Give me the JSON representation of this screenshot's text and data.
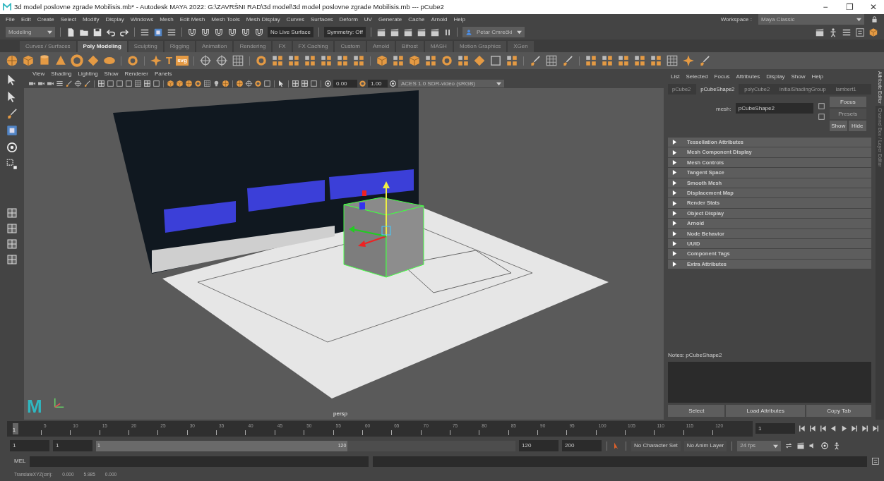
{
  "window": {
    "title": "3d model poslovne zgrade Mobilisis.mb* - Autodesk MAYA 2022: G:\\ZAVRŠNI RAD\\3d model\\3d model poslovne zgrade Mobilisis.mb  ---  pCube2",
    "controls": [
      "−",
      "❐",
      "✕"
    ]
  },
  "menu_bar": [
    "File",
    "Edit",
    "Create",
    "Select",
    "Modify",
    "Display",
    "Windows",
    "Mesh",
    "Edit Mesh",
    "Mesh Tools",
    "Mesh Display",
    "Curves",
    "Surfaces",
    "Deform",
    "UV",
    "Generate",
    "Cache",
    "Arnold",
    "Help"
  ],
  "workspace": {
    "label": "Workspace :",
    "value": "Maya Classic"
  },
  "status_line": {
    "mode": "Modeling",
    "live_surface": "No Live Surface",
    "symmetry": "Symmetry: Off",
    "user": "Petar Cmrečki"
  },
  "shelf": {
    "tabs": [
      {
        "label": "Curves / Surfaces",
        "selected": false
      },
      {
        "label": "Poly Modeling",
        "selected": true
      },
      {
        "label": "Sculpting",
        "selected": false
      },
      {
        "label": "Rigging",
        "selected": false
      },
      {
        "label": "Animation",
        "selected": false
      },
      {
        "label": "Rendering",
        "selected": false
      },
      {
        "label": "FX",
        "selected": false
      },
      {
        "label": "FX Caching",
        "selected": false
      },
      {
        "label": "Custom",
        "selected": false
      },
      {
        "label": "Arnold",
        "selected": false
      },
      {
        "label": "Bifrost",
        "selected": false
      },
      {
        "label": "MASH",
        "selected": false
      },
      {
        "label": "Motion Graphics",
        "selected": false
      },
      {
        "label": "XGen",
        "selected": false
      }
    ],
    "text_buttons": [
      "T",
      "svg"
    ]
  },
  "viewport": {
    "menus": [
      "View",
      "Shading",
      "Lighting",
      "Show",
      "Renderer",
      "Panels"
    ],
    "exposure": "0.00",
    "gamma": "1.00",
    "color_space": "ACES 1.0 SDR-video (sRGB)",
    "camera": "persp",
    "logo": "M"
  },
  "attribute_editor": {
    "menus": [
      "List",
      "Selected",
      "Focus",
      "Attributes",
      "Display",
      "Show",
      "Help"
    ],
    "tabs": [
      {
        "label": "pCube2",
        "selected": false
      },
      {
        "label": "pCubeShape2",
        "selected": true
      },
      {
        "label": "polyCube2",
        "selected": false
      },
      {
        "label": "initialShadingGroup",
        "selected": false
      },
      {
        "label": "lambert1",
        "selected": false
      }
    ],
    "node_label": "mesh:",
    "node_name": "pCubeShape2",
    "buttons": [
      {
        "label": "Focus",
        "disabled": false
      },
      {
        "label": "Presets",
        "disabled": true
      },
      {
        "label": "Show",
        "disabled": false
      },
      {
        "label": "Hide",
        "disabled": false
      }
    ],
    "sections": [
      {
        "label": "Tessellation Attributes",
        "expanded": false
      },
      {
        "label": "Mesh Component Display",
        "expanded": false
      },
      {
        "label": "Mesh Controls",
        "expanded": false
      },
      {
        "label": "Tangent Space",
        "expanded": false
      },
      {
        "label": "Smooth Mesh",
        "expanded": false
      },
      {
        "label": "Displacement Map",
        "expanded": false
      },
      {
        "label": "Render Stats",
        "expanded": false
      },
      {
        "label": "Object Display",
        "expanded": false
      },
      {
        "label": "Arnold",
        "expanded": false
      },
      {
        "label": "Node Behavior",
        "expanded": false
      },
      {
        "label": "UUID",
        "expanded": false
      },
      {
        "label": "Component Tags",
        "expanded": false
      },
      {
        "label": "Extra Attributes",
        "expanded": false
      }
    ],
    "notes_label": "Notes:  pCubeShape2",
    "bottom_buttons": [
      "Select",
      "Load Attributes",
      "Copy Tab"
    ]
  },
  "side_tabs": [
    {
      "label": "Attribute Editor",
      "selected": true
    },
    {
      "label": "Channel Box / Layer Editor",
      "selected": false
    }
  ],
  "timeline": {
    "ticks": [
      "5",
      "10",
      "15",
      "20",
      "25",
      "30",
      "35",
      "40",
      "45",
      "50",
      "55",
      "60",
      "65",
      "70",
      "75",
      "80",
      "85",
      "90",
      "95",
      "100",
      "105",
      "110",
      "115",
      "120"
    ],
    "current_frame": "1",
    "frame_field": "1"
  },
  "range": {
    "level": 0.6,
    "start": "1",
    "playback_start": "1",
    "slider_start": "1",
    "slider_end": "120",
    "playback_end": "120",
    "end": "200",
    "character_set": "No Character Set",
    "anim_layer": "No Anim Layer",
    "fps": "24 fps"
  },
  "command_line": {
    "language": "MEL"
  },
  "help_line": {
    "label": "TranslateXYZ(cm):",
    "values": [
      "0.000",
      "5.985",
      "0.000"
    ]
  }
}
